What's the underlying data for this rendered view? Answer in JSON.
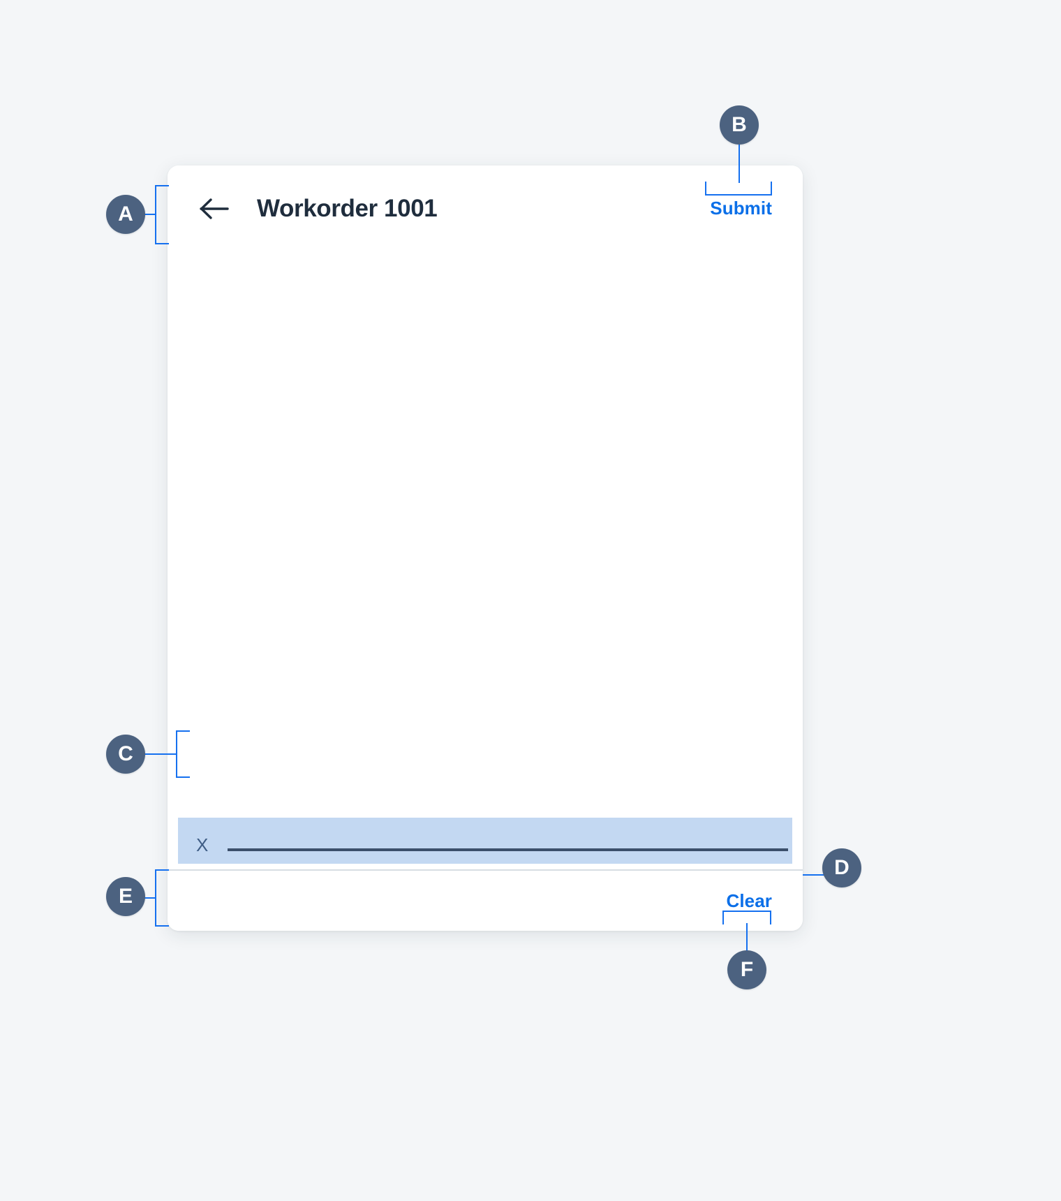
{
  "page": {
    "background_color": "#f4f6f8",
    "accent_color": "#0b6fe8",
    "badge_color": "#4c6280",
    "annotation_line_color": "#1570ef"
  },
  "header": {
    "back_icon": "arrow-left-icon",
    "title": "Workorder 1001",
    "submit_label": "Submit"
  },
  "body": {
    "field": {
      "label": "X",
      "value": "",
      "placeholder": "",
      "highlight_color": "#c3d8f2",
      "underline_color": "#3b4f6b"
    }
  },
  "footer": {
    "clear_label": "Clear",
    "divider_color": "#d7dde3"
  },
  "annotations": [
    {
      "id": "A",
      "label": "A",
      "target": "header-bar"
    },
    {
      "id": "B",
      "label": "B",
      "target": "submit-button"
    },
    {
      "id": "C",
      "label": "C",
      "target": "highlighted-field"
    },
    {
      "id": "D",
      "label": "D",
      "target": "footer-divider"
    },
    {
      "id": "E",
      "label": "E",
      "target": "footer-bar"
    },
    {
      "id": "F",
      "label": "F",
      "target": "clear-button"
    }
  ]
}
